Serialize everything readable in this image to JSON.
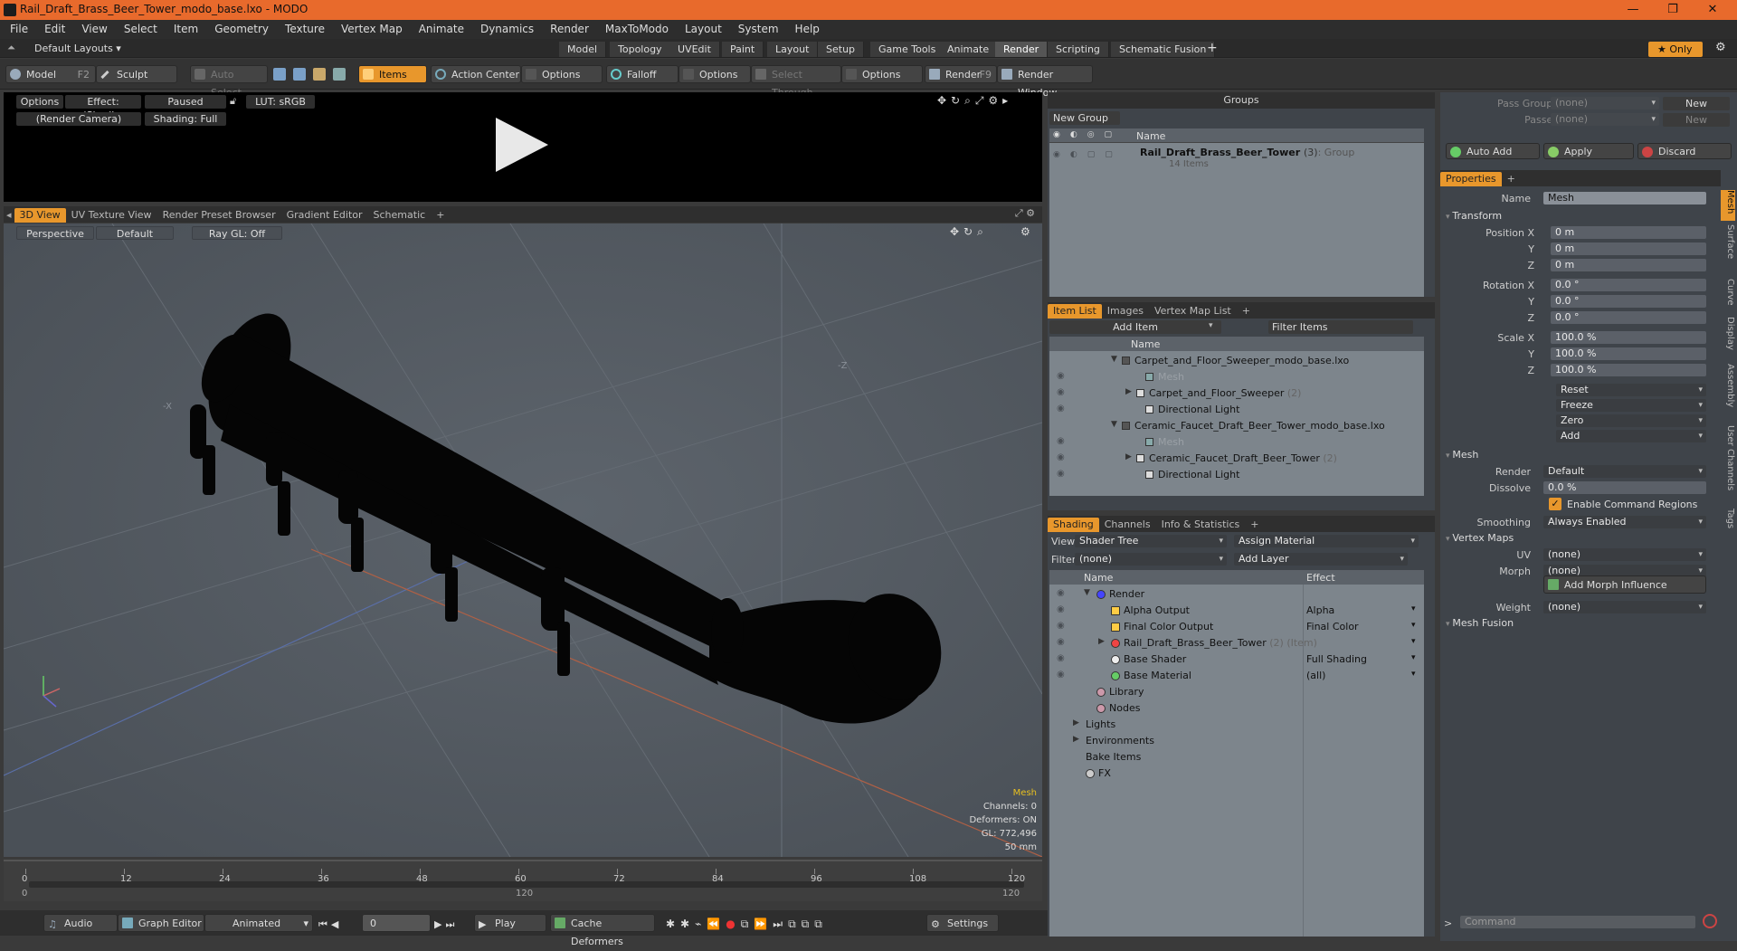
{
  "window": {
    "title": "Rail_Draft_Brass_Beer_Tower_modo_base.lxo - MODO",
    "min": "—",
    "max": "❐",
    "close": "✕"
  },
  "menu": [
    "File",
    "Edit",
    "View",
    "Select",
    "Item",
    "Geometry",
    "Texture",
    "Vertex Map",
    "Animate",
    "Dynamics",
    "Render",
    "MaxToModo",
    "Layout",
    "System",
    "Help"
  ],
  "layouts": {
    "label": "Default Layouts ▾",
    "tabs": [
      "Model",
      "Topology",
      "UVEdit",
      "Paint",
      "Layout",
      "Setup",
      "Game Tools",
      "Animate",
      "Render",
      "Scripting",
      "Schematic Fusion"
    ],
    "active": "Render",
    "add": "+",
    "only": "★ Only"
  },
  "toolbar": {
    "model": "Model",
    "model_key": "F2",
    "sculpt": "Sculpt",
    "auto_select": "Auto Select",
    "items": "Items",
    "action_center": "Action Center",
    "options1": "Options",
    "falloff": "Falloff",
    "options2": "Options",
    "select_through": "Select Through",
    "options3": "Options",
    "render": "Render",
    "render_key": "F9",
    "render_window": "Render Window"
  },
  "render_view": {
    "options": "Options",
    "effect": "Effect: (Shadi...",
    "paused": "Paused",
    "lut": "LUT: sRGB",
    "camera": "(Render Camera)",
    "shading": "Shading: Full"
  },
  "viewport_tabs": [
    "3D View",
    "UV Texture View",
    "Render Preset Browser",
    "Gradient Editor",
    "Schematic"
  ],
  "viewport": {
    "perspective": "Perspective",
    "default": "Default",
    "raygl": "Ray GL: Off",
    "axis_x": "-X",
    "axis_z": "-Z",
    "info": [
      "Mesh",
      "Channels: 0",
      "Deformers: ON",
      "GL: 772,496",
      "50 mm"
    ]
  },
  "timeline": {
    "ticks": [
      "0",
      "12",
      "24",
      "36",
      "48",
      "60",
      "72",
      "84",
      "96",
      "108",
      "120"
    ],
    "ticks2": [
      "0",
      "120",
      "120"
    ]
  },
  "bottombar": {
    "audio": "Audio",
    "graph_editor": "Graph Editor",
    "animated": "Animated",
    "frame": "0",
    "play": "Play",
    "cache": "Cache Deformers",
    "settings": "Settings"
  },
  "groups": {
    "title": "Groups",
    "new_group": "New Group",
    "col_name": "Name",
    "item_name": "Rail_Draft_Brass_Beer_Tower",
    "item_count": "(3)",
    "item_type": ": Group",
    "sub": "14 Items"
  },
  "itemlist": {
    "tabs": [
      "Item List",
      "Images",
      "Vertex Map List"
    ],
    "add_item": "Add Item",
    "filter": "Filter Items",
    "col_name": "Name",
    "rows": [
      {
        "t": "Carpet_and_Floor_Sweeper_modo_base.lxo",
        "lv": 0,
        "dim": false
      },
      {
        "t": "Mesh",
        "lv": 2,
        "dim": true
      },
      {
        "t": "Carpet_and_Floor_Sweeper",
        "n": "(2)",
        "lv": 1,
        "dim": false
      },
      {
        "t": "Directional Light",
        "lv": 2,
        "dim": false
      },
      {
        "t": "Ceramic_Faucet_Draft_Beer_Tower_modo_base.lxo",
        "lv": 0,
        "dim": false
      },
      {
        "t": "Mesh",
        "lv": 2,
        "dim": true
      },
      {
        "t": "Ceramic_Faucet_Draft_Beer_Tower",
        "n": "(2)",
        "lv": 1,
        "dim": false
      },
      {
        "t": "Directional Light",
        "lv": 2,
        "dim": false
      }
    ]
  },
  "shading": {
    "tabs": [
      "Shading",
      "Channels",
      "Info & Statistics"
    ],
    "view_lbl": "View",
    "view": "Shader Tree",
    "assign": "Assign Material",
    "filter_lbl": "Filter",
    "filter": "(none)",
    "add_layer": "Add Layer",
    "col_name": "Name",
    "col_effect": "Effect",
    "rows": [
      {
        "t": "Render",
        "e": "",
        "lv": 0
      },
      {
        "t": "Alpha Output",
        "e": "Alpha",
        "lv": 1
      },
      {
        "t": "Final Color Output",
        "e": "Final Color",
        "lv": 1
      },
      {
        "t": "Rail_Draft_Brass_Beer_Tower",
        "n": "(2) (Item)",
        "e": "",
        "lv": 1
      },
      {
        "t": "Base Shader",
        "e": "Full Shading",
        "lv": 1
      },
      {
        "t": "Base Material",
        "e": "(all)",
        "lv": 1
      },
      {
        "t": "Library",
        "e": "",
        "lv": 0
      },
      {
        "t": "Nodes",
        "e": "",
        "lv": 0
      },
      {
        "t": "Lights",
        "e": "",
        "lv": -1
      },
      {
        "t": "Environments",
        "e": "",
        "lv": -1
      },
      {
        "t": "Bake Items",
        "e": "",
        "lv": -1
      },
      {
        "t": "FX",
        "e": "",
        "lv": -1
      }
    ]
  },
  "props": {
    "pass_groups": "Pass Groups",
    "pass_groups_val": "(none)",
    "passes": "Passes",
    "passes_val": "(none)",
    "new1": "New",
    "new2": "New",
    "auto_add": "Auto Add",
    "apply": "Apply",
    "discard": "Discard",
    "tab": "Properties",
    "name_lbl": "Name",
    "name": "Mesh",
    "transform": "Transform",
    "pos": [
      {
        "l": "Position X",
        "v": "0 m"
      },
      {
        "l": "Y",
        "v": "0 m"
      },
      {
        "l": "Z",
        "v": "0 m"
      }
    ],
    "rot": [
      {
        "l": "Rotation X",
        "v": "0.0 °"
      },
      {
        "l": "Y",
        "v": "0.0 °"
      },
      {
        "l": "Z",
        "v": "0.0 °"
      }
    ],
    "scale": [
      {
        "l": "Scale X",
        "v": "100.0 %"
      },
      {
        "l": "Y",
        "v": "100.0 %"
      },
      {
        "l": "Z",
        "v": "100.0 %"
      }
    ],
    "actions": [
      "Reset",
      "Freeze",
      "Zero",
      "Add"
    ],
    "mesh": "Mesh",
    "render_lbl": "Render",
    "render": "Default",
    "dissolve_lbl": "Dissolve",
    "dissolve": "0.0 %",
    "enable_cmd": "Enable Command Regions",
    "smoothing_lbl": "Smoothing",
    "smoothing": "Always Enabled",
    "vertex_maps": "Vertex Maps",
    "uv_lbl": "UV",
    "uv": "(none)",
    "morph_lbl": "Morph",
    "morph": "(none)",
    "add_morph": "Add Morph Influence",
    "weight_lbl": "Weight",
    "weight": "(none)",
    "mesh_fusion": "Mesh Fusion",
    "command": "Command",
    "side_tabs": [
      "Mesh",
      "Surface",
      "Curve",
      "Display",
      "Assembly",
      "User Channels",
      "Tags"
    ]
  },
  "colors": {
    "accent": "#e8972c",
    "title": "#e86a2c"
  }
}
